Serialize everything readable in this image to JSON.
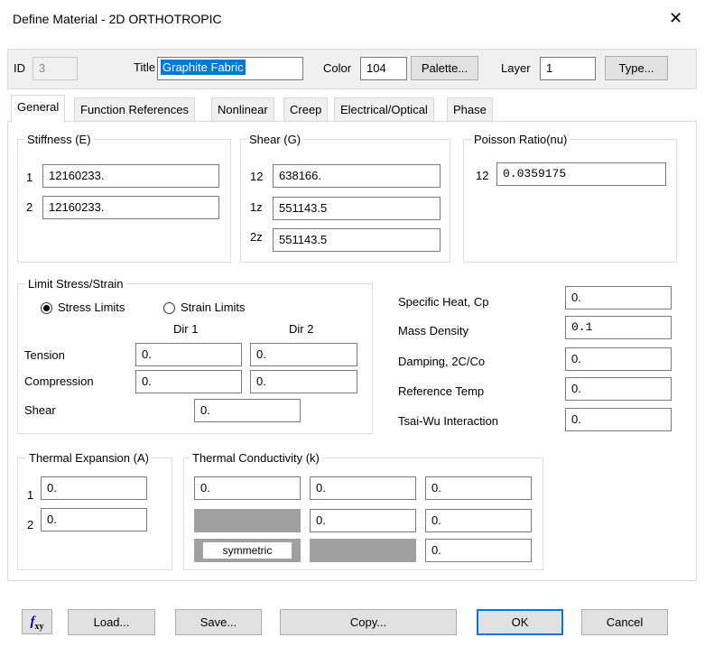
{
  "window": {
    "title": "Define Material - 2D ORTHOTROPIC",
    "close_glyph": "✕"
  },
  "header": {
    "id_label": "ID",
    "id_value": "3",
    "title_label": "Title",
    "title_value": "Graphite Fabric",
    "color_label": "Color",
    "color_value": "104",
    "palette_label": "Palette...",
    "layer_label": "Layer",
    "layer_value": "1",
    "type_label": "Type..."
  },
  "tabs": [
    {
      "label": "General"
    },
    {
      "label": "Function References"
    },
    {
      "label": "Nonlinear"
    },
    {
      "label": "Creep"
    },
    {
      "label": "Electrical/Optical"
    },
    {
      "label": "Phase"
    }
  ],
  "stiffness": {
    "title": "Stiffness (E)",
    "rows": [
      {
        "label": "1",
        "value": "12160233."
      },
      {
        "label": "2",
        "value": "12160233."
      }
    ]
  },
  "shear": {
    "title": "Shear (G)",
    "rows": [
      {
        "label": "12",
        "value": "638166."
      },
      {
        "label": "1z",
        "value": "551143.5"
      },
      {
        "label": "2z",
        "value": "551143.5"
      }
    ]
  },
  "poisson": {
    "title": "Poisson Ratio(nu)",
    "label": "12",
    "value": "0.0359175"
  },
  "limit": {
    "title": "Limit Stress/Strain",
    "stress_label": "Stress Limits",
    "strain_label": "Strain Limits",
    "dir1": "Dir 1",
    "dir2": "Dir 2",
    "tension_label": "Tension",
    "tension_1": "0.",
    "tension_2": "0.",
    "compression_label": "Compression",
    "compression_1": "0.",
    "compression_2": "0.",
    "shear_label": "Shear",
    "shear_value": "0."
  },
  "props": [
    {
      "label": "Specific Heat, Cp",
      "value": "0."
    },
    {
      "label": "Mass Density",
      "value": "0.1"
    },
    {
      "label": "Damping, 2C/Co",
      "value": "0."
    },
    {
      "label": "Reference Temp",
      "value": "0."
    },
    {
      "label": "Tsai-Wu Interaction",
      "value": "0."
    }
  ],
  "thermal_expansion": {
    "title": "Thermal Expansion (A)",
    "rows": [
      {
        "label": "1",
        "value": "0."
      },
      {
        "label": "2",
        "value": "0."
      }
    ]
  },
  "thermal_conductivity": {
    "title": "Thermal Conductivity (k)",
    "r1": [
      "0.",
      "0.",
      "0."
    ],
    "r2": [
      "0.",
      "0."
    ],
    "r3": [
      "0."
    ],
    "symmetric_label": "symmetric"
  },
  "footer": {
    "fxy_icon": "function-xy-icon",
    "load": "Load...",
    "save": "Save...",
    "copy": "Copy...",
    "ok": "OK",
    "cancel": "Cancel"
  }
}
